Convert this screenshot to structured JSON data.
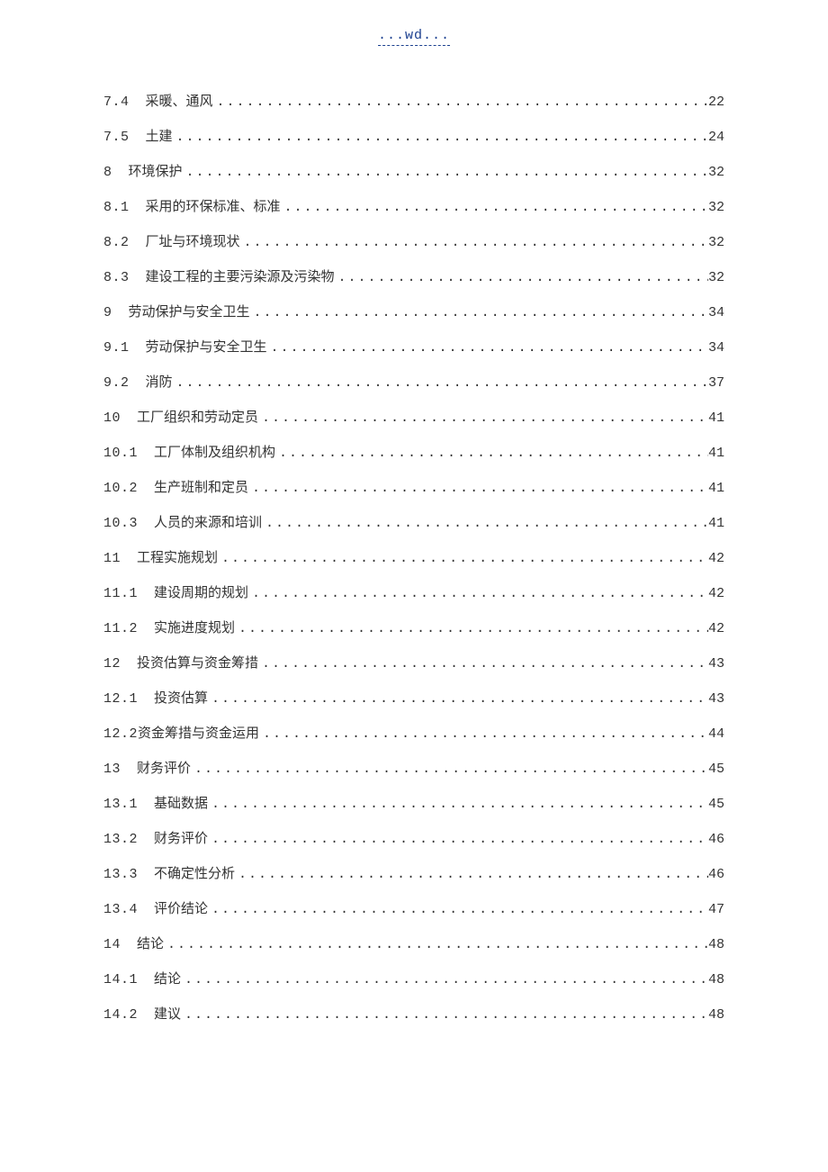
{
  "header": {
    "text": "...wd..."
  },
  "toc": [
    {
      "num": "7.4",
      "title": "采暖、通风",
      "page": "22"
    },
    {
      "num": "7.5",
      "title": "土建",
      "page": "24"
    },
    {
      "num": "8",
      "title": "环境保护",
      "page": "32"
    },
    {
      "num": "8.1",
      "title": "采用的环保标准、标准",
      "page": "32"
    },
    {
      "num": "8.2",
      "title": "厂址与环境现状",
      "page": "32"
    },
    {
      "num": "8.3",
      "title": "建设工程的主要污染源及污染物",
      "page": "32"
    },
    {
      "num": "9",
      "title": "劳动保护与安全卫生",
      "page": "34"
    },
    {
      "num": "9.1",
      "title": "劳动保护与安全卫生",
      "page": "34"
    },
    {
      "num": "9.2",
      "title": "消防",
      "page": "37"
    },
    {
      "num": "10",
      "title": "工厂组织和劳动定员",
      "page": "41"
    },
    {
      "num": "10.1",
      "title": "工厂体制及组织机构",
      "page": "41"
    },
    {
      "num": "10.2",
      "title": "生产班制和定员",
      "page": "41"
    },
    {
      "num": "10.3",
      "title": "人员的来源和培训",
      "page": "41"
    },
    {
      "num": "11",
      "title": "工程实施规划",
      "page": "42"
    },
    {
      "num": "11.1",
      "title": "建设周期的规划",
      "page": "42"
    },
    {
      "num": "11.2",
      "title": "实施进度规划",
      "page": "42"
    },
    {
      "num": "12",
      "title": "投资估算与资金筹措",
      "page": "43"
    },
    {
      "num": "12.1",
      "title": "投资估算",
      "page": "43"
    },
    {
      "num": "12.2",
      "title": "资金筹措与资金运用",
      "page": "44",
      "nogap": true
    },
    {
      "num": "13",
      "title": "财务评价",
      "page": "45"
    },
    {
      "num": "13.1",
      "title": "基础数据",
      "page": "45"
    },
    {
      "num": "13.2",
      "title": "财务评价",
      "page": "46"
    },
    {
      "num": "13.3",
      "title": "不确定性分析",
      "page": "46"
    },
    {
      "num": "13.4",
      "title": "评价结论",
      "page": "47"
    },
    {
      "num": "14",
      "title": "结论",
      "page": "48"
    },
    {
      "num": "14.1",
      "title": "结论",
      "page": "48"
    },
    {
      "num": "14.2",
      "title": "建议",
      "page": "48"
    }
  ]
}
